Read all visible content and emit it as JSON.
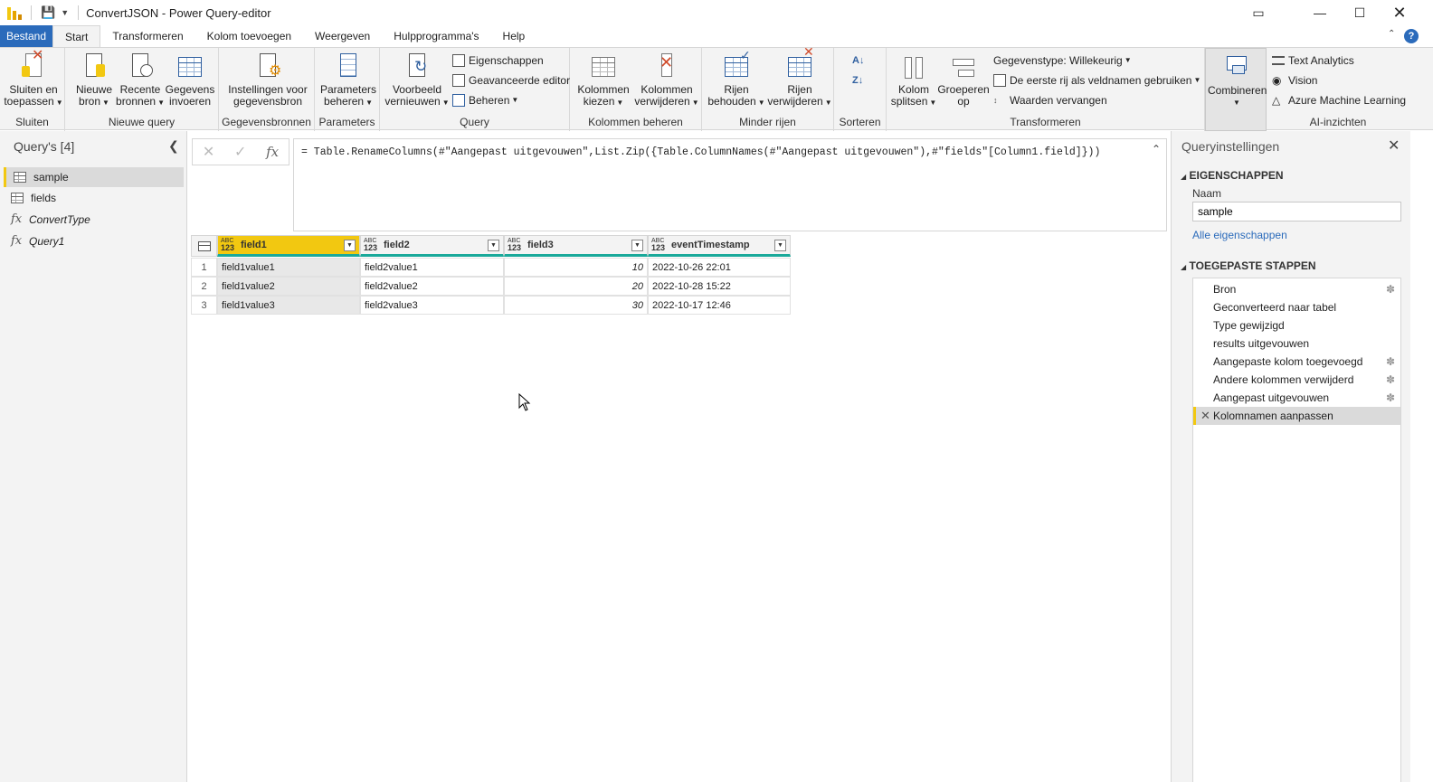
{
  "window": {
    "title": "ConvertJSON - Power Query-editor"
  },
  "menu": {
    "tabs": [
      "Bestand",
      "Start",
      "Transformeren",
      "Kolom toevoegen",
      "Weergeven",
      "Hulpprogramma's",
      "Help"
    ]
  },
  "ribbon": {
    "close_apply": [
      "Sluiten en",
      "toepassen"
    ],
    "new_source": [
      "Nieuwe",
      "bron"
    ],
    "recent_sources": [
      "Recente",
      "bronnen"
    ],
    "enter_data": [
      "Gegevens",
      "invoeren"
    ],
    "source_settings": [
      "Instellingen voor",
      "gegevensbron"
    ],
    "manage_params": [
      "Parameters",
      "beheren"
    ],
    "refresh_preview": [
      "Voorbeeld",
      "vernieuwen"
    ],
    "properties": "Eigenschappen",
    "advanced_editor": "Geavanceerde editor",
    "manage": "Beheren",
    "choose_columns": [
      "Kolommen",
      "kiezen"
    ],
    "remove_columns": [
      "Kolommen",
      "verwijderen"
    ],
    "keep_rows": [
      "Rijen",
      "behouden"
    ],
    "remove_rows": [
      "Rijen",
      "verwijderen"
    ],
    "split_column": [
      "Kolom",
      "splitsen"
    ],
    "group_by": [
      "Groeperen",
      "op"
    ],
    "data_type": "Gegevenstype: Willekeurig",
    "first_row_headers": "De eerste rij als veldnamen gebruiken",
    "replace_values": "Waarden vervangen",
    "combine": "Combineren",
    "text_analytics": "Text Analytics",
    "vision": "Vision",
    "azure_ml": "Azure Machine Learning",
    "groups": {
      "close": "Sluiten",
      "new_query": "Nieuwe query",
      "data_sources": "Gegevensbronnen",
      "parameters": "Parameters",
      "query": "Query",
      "manage_columns": "Kolommen beheren",
      "reduce_rows": "Minder rijen",
      "sort": "Sorteren",
      "transform": "Transformeren",
      "ai": "AI-inzichten"
    }
  },
  "queries": {
    "title": "Query's [4]",
    "items": [
      {
        "name": "sample",
        "type": "table-icon",
        "selected": true
      },
      {
        "name": "fields",
        "type": "table-icon",
        "selected": false
      },
      {
        "name": "ConvertType",
        "type": "fx-icon",
        "selected": false
      },
      {
        "name": "Query1",
        "type": "fx-icon",
        "selected": false
      }
    ]
  },
  "formula": {
    "text": "= Table.RenameColumns(#\"Aangepast uitgevouwen\",List.Zip({Table.ColumnNames(#\"Aangepast uitgevouwen\"),#\"fields\"[Column1.field]}))"
  },
  "grid": {
    "type_label_top": "ABC",
    "type_label_bottom": "123",
    "columns": [
      "field1",
      "field2",
      "field3",
      "eventTimestamp"
    ],
    "rows": [
      {
        "n": "1",
        "cells": [
          "field1value1",
          "field2value1",
          "10",
          "2022-10-26 22:01"
        ]
      },
      {
        "n": "2",
        "cells": [
          "field1value2",
          "field2value2",
          "20",
          "2022-10-28 15:22"
        ]
      },
      {
        "n": "3",
        "cells": [
          "field1value3",
          "field2value3",
          "30",
          "2022-10-17 12:46"
        ]
      }
    ]
  },
  "settings": {
    "title": "Queryinstellingen",
    "properties_title": "EIGENSCHAPPEN",
    "name_label": "Naam",
    "name_value": "sample",
    "all_properties": "Alle eigenschappen",
    "steps_title": "TOEGEPASTE STAPPEN",
    "steps": [
      {
        "label": "Bron",
        "gear": true
      },
      {
        "label": "Geconverteerd naar tabel",
        "gear": false
      },
      {
        "label": "Type gewijzigd",
        "gear": false
      },
      {
        "label": "results uitgevouwen",
        "gear": false
      },
      {
        "label": "Aangepaste kolom toegevoegd",
        "gear": true
      },
      {
        "label": "Andere kolommen verwijderd",
        "gear": true
      },
      {
        "label": "Aangepast uitgevouwen",
        "gear": true
      },
      {
        "label": "Kolomnamen aanpassen",
        "gear": false,
        "active": true
      }
    ]
  },
  "colors": {
    "accent_yellow": "#f2c811",
    "file_tab_blue": "#2b6bbb",
    "column_quality_teal": "#1aa99a"
  }
}
